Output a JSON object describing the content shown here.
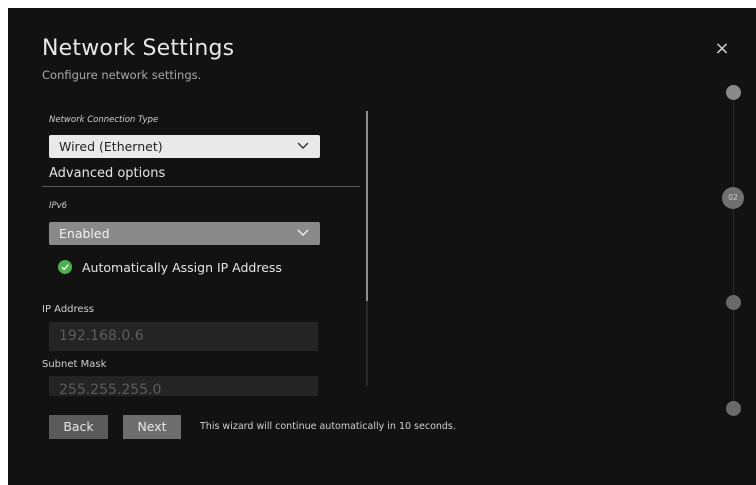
{
  "header": {
    "title": "Network Settings",
    "subtitle": "Configure network settings.",
    "close_glyph": "×"
  },
  "form": {
    "connection_type": {
      "label": "Network Connection Type",
      "value": "Wired (Ethernet)"
    },
    "advanced_heading": "Advanced options",
    "ipv6": {
      "label": "IPv6",
      "value": "Enabled"
    },
    "auto_ip": {
      "label": "Automatically Assign IP Address",
      "checked": true
    },
    "ip_address": {
      "label": "IP Address",
      "value": "192.168.0.6"
    },
    "subnet_mask": {
      "label": "Subnet Mask",
      "value": "255.255.255.0"
    }
  },
  "footer": {
    "back_label": "Back",
    "next_label": "Next",
    "hint": "This wizard will continue automatically in 10 seconds."
  },
  "steps": {
    "current_label": "02"
  },
  "colors": {
    "background": "#121212",
    "check_green": "#4caf50",
    "select_light": "#e9e9e9",
    "select_gray": "#8a8a8a"
  }
}
